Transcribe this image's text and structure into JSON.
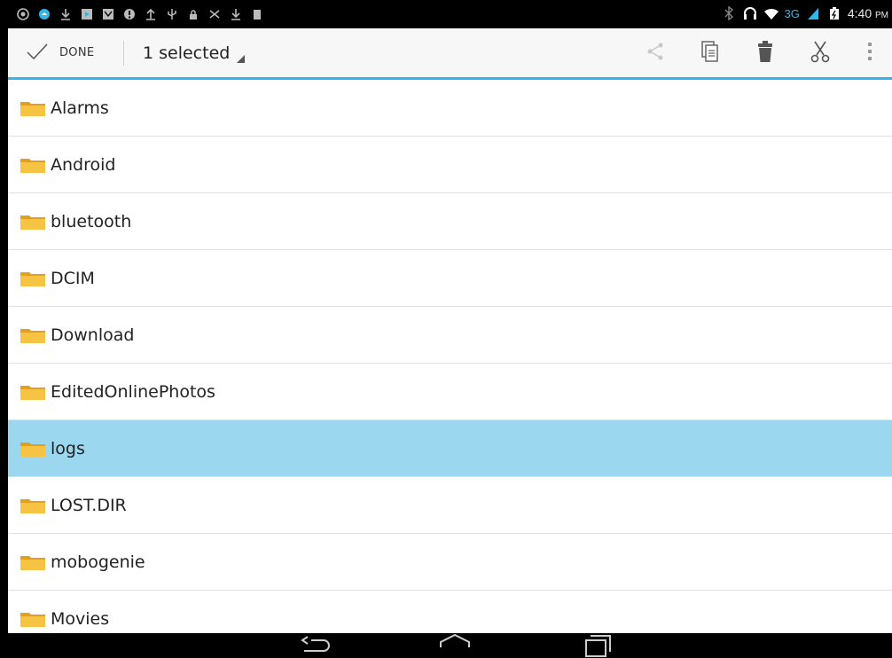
{
  "status_bar": {
    "time": "4:40",
    "ampm": "PM",
    "network": "3G",
    "left_icons": [
      "screenshot-icon",
      "android-icon",
      "download-icon",
      "play-store-icon",
      "mail-icon",
      "alert-icon",
      "upload-icon",
      "usb-icon",
      "lock-icon",
      "scissors-app-icon",
      "download-icon",
      "battery-small-icon"
    ],
    "right_icons": [
      "bluetooth-icon",
      "headset-icon",
      "wifi-icon",
      "signal-icon",
      "battery-icon"
    ]
  },
  "action_bar": {
    "done_label": "DONE",
    "selected_label": "1 selected",
    "actions": [
      {
        "name": "share-icon"
      },
      {
        "name": "copy-icon"
      },
      {
        "name": "delete-icon"
      },
      {
        "name": "cut-icon"
      },
      {
        "name": "overflow-menu-icon"
      }
    ]
  },
  "folders": [
    {
      "label": "Alarms",
      "selected": false
    },
    {
      "label": "Android",
      "selected": false
    },
    {
      "label": "bluetooth",
      "selected": false
    },
    {
      "label": "DCIM",
      "selected": false
    },
    {
      "label": "Download",
      "selected": false
    },
    {
      "label": "EditedOnlinePhotos",
      "selected": false
    },
    {
      "label": "logs",
      "selected": true
    },
    {
      "label": "LOST.DIR",
      "selected": false
    },
    {
      "label": "mobogenie",
      "selected": false
    },
    {
      "label": "Movies",
      "selected": false
    }
  ],
  "nav_bar": [
    "back-icon",
    "home-icon",
    "recents-icon"
  ],
  "colors": {
    "accent": "#33b5e5",
    "selection": "#9bd8ef",
    "folder": "#f2b92b"
  }
}
